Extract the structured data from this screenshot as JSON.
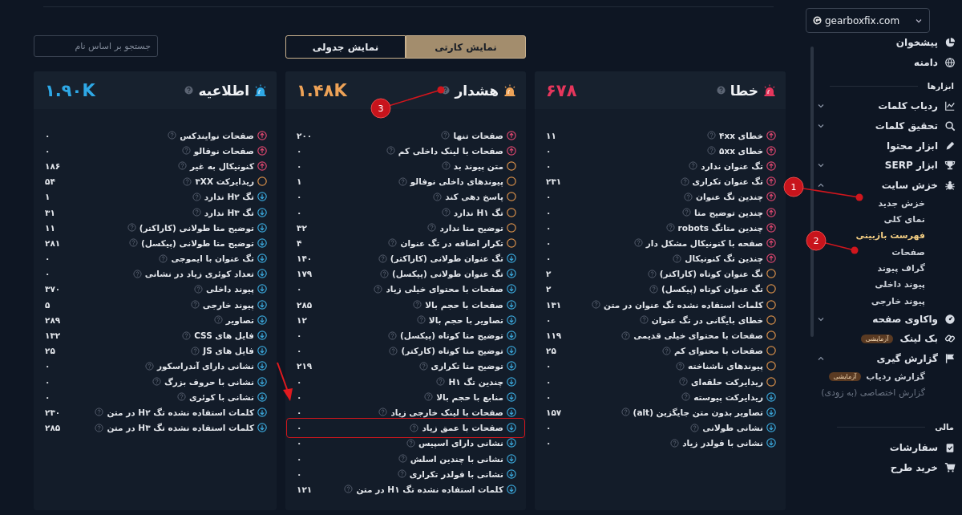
{
  "domain_selector": {
    "value": "gearboxfix.com"
  },
  "sidebar": {
    "sections": [
      {
        "items": [
          {
            "label": "پیشخوان"
          },
          {
            "label": "دامنه"
          }
        ]
      },
      {
        "heading": "ابزارها",
        "items": [
          {
            "label": "ردیاب کلمات",
            "expanded": false
          },
          {
            "label": "تحقیق کلمات",
            "expanded": false
          },
          {
            "label": "ابزار محتوا"
          },
          {
            "label": "ابزار SERP",
            "expanded": false
          },
          {
            "label": "خزش سایت",
            "expanded": true,
            "children": [
              {
                "label": "خزش جدید",
                "selected": false,
                "disabled": false
              },
              {
                "label": "نمای کلی",
                "selected": false,
                "disabled": false
              },
              {
                "label": "فهرست بازبینی",
                "selected": true,
                "disabled": false
              },
              {
                "label": "صفحات",
                "selected": false,
                "disabled": false
              },
              {
                "label": "گراف پیوند",
                "selected": false,
                "disabled": false
              },
              {
                "label": "پیوند داخلی",
                "selected": false,
                "disabled": false
              },
              {
                "label": "پیوند خارجی",
                "selected": false,
                "disabled": false
              }
            ]
          },
          {
            "label": "واکاوی صفحه",
            "expanded": false
          },
          {
            "label": "بک لینک",
            "badge": "آزمایشی"
          },
          {
            "label": "گزارش گیری",
            "expanded": true,
            "children": [
              {
                "label": "گزارش ردیاب",
                "badge": "آزمایشی",
                "selected": false,
                "disabled": false
              },
              {
                "label": "گزارش اختصاصی (به زودی)",
                "selected": false,
                "disabled": true
              }
            ]
          }
        ]
      },
      {
        "heading": "مالی",
        "items": [
          {
            "label": "سفارشات"
          },
          {
            "label": "خرید طرح"
          }
        ]
      }
    ]
  },
  "view_toggle": [
    {
      "label": "نمایش کارتی",
      "selected": true
    },
    {
      "label": "نمایش جدولی",
      "selected": false
    }
  ],
  "search": {
    "placeholder": "جستجو بر اساس نام"
  },
  "cards": [
    {
      "kind": "error",
      "title": "خطا",
      "count": "۶۷۸",
      "rows": [
        {
          "kind": "high",
          "label": "خطای ۴xx",
          "value": "۱۱"
        },
        {
          "kind": "high",
          "label": "خطای ۵xx",
          "value": "۰"
        },
        {
          "kind": "high",
          "label": "تگ عنوان ندارد",
          "value": "۰"
        },
        {
          "kind": "high",
          "label": "تگ عنوان تکراری",
          "value": "۲۳۱"
        },
        {
          "kind": "high",
          "label": "چندین تگ عنوان",
          "value": "۰"
        },
        {
          "kind": "high",
          "label": "چندین توضیح متا",
          "value": "۰"
        },
        {
          "kind": "high",
          "label": "چندین متاتگ robots",
          "value": "۰"
        },
        {
          "kind": "high",
          "label": "صفحه با کنونیکال مشکل دار",
          "value": "۰"
        },
        {
          "kind": "high",
          "label": "چندین تگ کنونیکال",
          "value": "۰"
        },
        {
          "kind": "medium",
          "label": "تگ عنوان کوتاه (کاراکتر)",
          "value": "۲"
        },
        {
          "kind": "medium",
          "label": "تگ عنوان کوتاه (پیکسل)",
          "value": "۲"
        },
        {
          "kind": "medium",
          "label": "کلمات استفاده نشده تگ عنوان در متن",
          "value": "۱۳۱"
        },
        {
          "kind": "medium",
          "label": "خطای بایگانی در تگ عنوان",
          "value": "۰"
        },
        {
          "kind": "medium",
          "label": "صفحات با محتوای خیلی قدیمی",
          "value": "۱۱۹"
        },
        {
          "kind": "medium",
          "label": "صفحات با محتوای کم",
          "value": "۲۵"
        },
        {
          "kind": "medium",
          "label": "پیوندهای ناشناخته",
          "value": "۰"
        },
        {
          "kind": "medium",
          "label": "ریدایرکت حلقه‌ای",
          "value": "۰"
        },
        {
          "kind": "low",
          "label": "ریدایرکت پیوسته",
          "value": "۰"
        },
        {
          "kind": "low",
          "label": "تصاویر بدون متن جایگزین (alt)",
          "value": "۱۵۷"
        },
        {
          "kind": "low",
          "label": "نشانی طولانی",
          "value": "۰"
        },
        {
          "kind": "low",
          "label": "نشانی با فولدر زیاد",
          "value": "۰"
        }
      ]
    },
    {
      "kind": "warning",
      "title": "هشدار",
      "count": "۱.۴۸K",
      "rows": [
        {
          "kind": "high",
          "label": "صفحات تنها",
          "value": "۲۰۰"
        },
        {
          "kind": "high",
          "label": "صفحات با لینک داخلی کم",
          "value": "۰"
        },
        {
          "kind": "medium",
          "label": "متن پیوند بد",
          "value": "۰"
        },
        {
          "kind": "medium",
          "label": "پیوندهای داخلی نوفالو",
          "value": "۱"
        },
        {
          "kind": "medium",
          "label": "پاسخ دهی کند",
          "value": "۰"
        },
        {
          "kind": "medium",
          "label": "تگ H۱ ندارد",
          "value": "۰"
        },
        {
          "kind": "medium",
          "label": "توضیح متا ندارد",
          "value": "۳۲"
        },
        {
          "kind": "medium",
          "label": "تکرار اضافه در تگ عنوان",
          "value": "۴"
        },
        {
          "kind": "low",
          "label": "تگ عنوان طولانی (کاراکتر)",
          "value": "۱۴۰"
        },
        {
          "kind": "low",
          "label": "تگ عنوان طولانی (پیکسل)",
          "value": "۱۷۹"
        },
        {
          "kind": "low",
          "label": "صفحات با محتوای خیلی زیاد",
          "value": "۰"
        },
        {
          "kind": "low",
          "label": "صفحات با حجم بالا",
          "value": "۲۸۵"
        },
        {
          "kind": "low",
          "label": "تصاویر با حجم بالا",
          "value": "۱۲"
        },
        {
          "kind": "low",
          "label": "توضیح متا کوتاه (پیکسل)",
          "value": "۰"
        },
        {
          "kind": "low",
          "label": "توضیح متا کوتاه (کارکتر)",
          "value": "۰"
        },
        {
          "kind": "low",
          "label": "توضیح متا تکراری",
          "value": "۲۱۹"
        },
        {
          "kind": "low",
          "label": "چندین تگ H۱",
          "value": "۰"
        },
        {
          "kind": "low",
          "label": "منابع با حجم بالا",
          "value": "۰"
        },
        {
          "kind": "low",
          "label": "صفحات با لینک خارجی زیاد",
          "value": "۰"
        },
        {
          "kind": "low",
          "label": "صفحات با عمق زیاد",
          "value": "۰",
          "highlighted": true
        },
        {
          "kind": "low",
          "label": "نشانی دارای اسپیس",
          "value": "۰"
        },
        {
          "kind": "low",
          "label": "نشانی با چندین اسلش",
          "value": "۰"
        },
        {
          "kind": "low",
          "label": "نشانی با فولدر تکراری",
          "value": "۰"
        },
        {
          "kind": "low",
          "label": "کلمات استفاده نشده تگ H۱ در متن",
          "value": "۱۲۱"
        }
      ]
    },
    {
      "kind": "notice",
      "title": "اطلاعیه",
      "count": "۱.۹۰K",
      "rows": [
        {
          "kind": "high",
          "label": "صفحات نوایندکس",
          "value": "۰"
        },
        {
          "kind": "high",
          "label": "صفحات نوفالو",
          "value": "۰"
        },
        {
          "kind": "high",
          "label": "کنونیکال به غیر",
          "value": "۱۸۶"
        },
        {
          "kind": "medium",
          "label": "ریدایرکت ۳XX",
          "value": "۵۴"
        },
        {
          "kind": "low",
          "label": "تگ H۲ ندارد",
          "value": "۱"
        },
        {
          "kind": "low",
          "label": "تگ H۳ ندارد",
          "value": "۳۱"
        },
        {
          "kind": "low",
          "label": "توضیح متا طولانی (کاراکتر)",
          "value": "۱۱"
        },
        {
          "kind": "low",
          "label": "توضیح متا طولانی (پیکسل)",
          "value": "۲۸۱"
        },
        {
          "kind": "low",
          "label": "تگ عنوان با ایموجی",
          "value": "۰"
        },
        {
          "kind": "low",
          "label": "تعداد کوئری زیاد در نشانی",
          "value": "۰"
        },
        {
          "kind": "low",
          "label": "پیوند داخلی",
          "value": "۳۷۰"
        },
        {
          "kind": "low",
          "label": "پیوند خارجی",
          "value": "۵"
        },
        {
          "kind": "low",
          "label": "تصاویر",
          "value": "۲۸۹"
        },
        {
          "kind": "low",
          "label": "فایل های CSS",
          "value": "۱۳۲"
        },
        {
          "kind": "low",
          "label": "فایل های JS",
          "value": "۲۵"
        },
        {
          "kind": "low",
          "label": "نشانی دارای آندراسکور",
          "value": "۰"
        },
        {
          "kind": "low",
          "label": "نشانی با حروف بزرگ",
          "value": "۰"
        },
        {
          "kind": "low",
          "label": "نشانی با کوئری",
          "value": "۰"
        },
        {
          "kind": "low",
          "label": "کلمات استفاده نشده تگ H۲ در متن",
          "value": "۲۳۰"
        },
        {
          "kind": "low",
          "label": "کلمات استفاده نشده تگ H۳ در متن",
          "value": "۲۸۵"
        }
      ]
    }
  ],
  "annotations": [
    {
      "kind": "marker",
      "label": "1"
    },
    {
      "kind": "marker",
      "label": "2"
    },
    {
      "kind": "marker",
      "label": "3"
    },
    {
      "kind": "arrow"
    }
  ]
}
